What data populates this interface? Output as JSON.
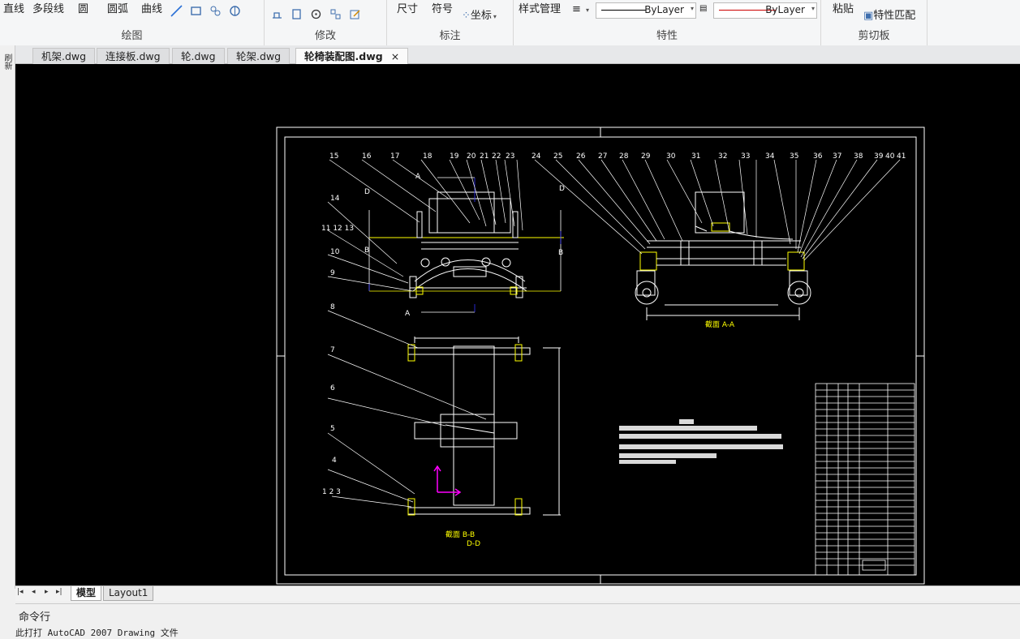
{
  "ribbon": {
    "draw": {
      "title": "绘图",
      "line": "直线",
      "polyline": "多段线",
      "circle": "圆",
      "arc": "圆弧",
      "curve": "曲线"
    },
    "modify": {
      "title": "修改"
    },
    "annotate": {
      "title": "标注",
      "dimension": "尺寸",
      "symbol": "符号",
      "coordinate": "坐标"
    },
    "properties": {
      "title": "特性",
      "style_manager": "样式管理",
      "linetype_value": "ByLayer",
      "lineweight_value": "ByLayer",
      "linetype_color": "#000000",
      "lineweight_color": "#cc0000"
    },
    "clipboard": {
      "title": "剪切板",
      "paste": "粘贴",
      "match_properties": "特性匹配"
    }
  },
  "tabs": [
    {
      "label": "机架.dwg"
    },
    {
      "label": "连接板.dwg"
    },
    {
      "label": "轮.dwg"
    },
    {
      "label": "轮架.dwg"
    },
    {
      "label": "轮椅装配图.dwg",
      "active": true
    }
  ],
  "tab_close": "×",
  "left_strip": "刷新",
  "drawing": {
    "top_numbers": [
      "15",
      "16",
      "17",
      "18",
      "19",
      "20",
      "21",
      "22",
      "23",
      "24",
      "25",
      "26",
      "27",
      "28",
      "29",
      "30",
      "31",
      "32",
      "33",
      "34",
      "35",
      "36",
      "37",
      "38",
      "39",
      "40",
      "41"
    ],
    "left_numbers": [
      "14",
      "11 12 13",
      "10",
      "9",
      "8",
      "7",
      "6",
      "5",
      "4",
      "1 2 3"
    ],
    "section_aa": "截面  A-A",
    "section_bb": "截面  B-B",
    "section_dd": "D-D",
    "letters": {
      "a": "A",
      "b": "B",
      "d": "D"
    },
    "colors": {
      "white": "#ffffff",
      "yellow": "#ffff00",
      "magenta": "#ff00ff",
      "blue": "#3333ff",
      "frame": "#ffffff"
    }
  },
  "layout_tabs": [
    {
      "label": "模型",
      "active": true
    },
    {
      "label": "Layout1"
    }
  ],
  "nav_arrows": {
    "first": "|◂",
    "prev": "◂",
    "next": "▸",
    "last": "▸|"
  },
  "command": {
    "label": "命令行",
    "history": "此打打 AutoCAD 2007 Drawing 文件"
  }
}
